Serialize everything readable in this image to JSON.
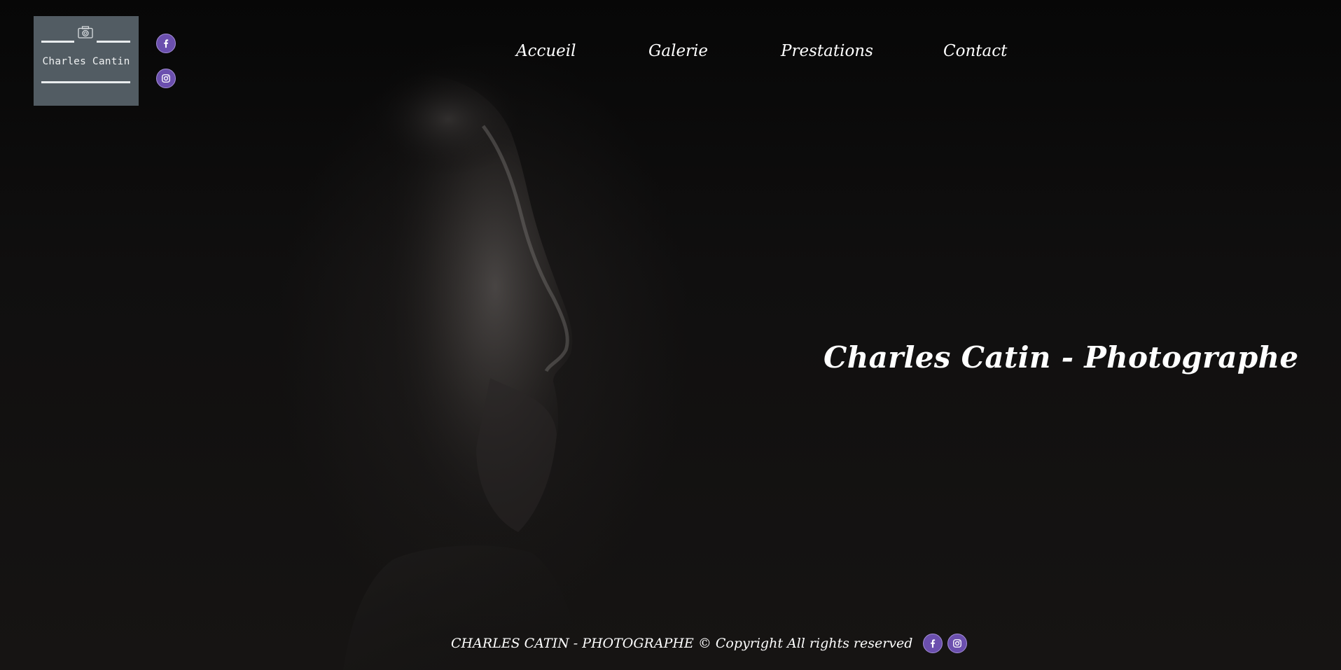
{
  "logo": {
    "text": "Charles Cantin",
    "icon": "camera-icon"
  },
  "social": {
    "facebook_icon": "facebook-icon",
    "instagram_icon": "instagram-icon",
    "accent_color": "#6b4fae"
  },
  "nav": {
    "items": [
      {
        "label": "Accueil"
      },
      {
        "label": "Galerie"
      },
      {
        "label": "Prestations"
      },
      {
        "label": "Contact"
      }
    ]
  },
  "hero": {
    "headline": "Charles Catin - Photographe"
  },
  "footer": {
    "text": "CHARLES CATIN - PHOTOGRAPHE © Copyright All rights reserved"
  }
}
